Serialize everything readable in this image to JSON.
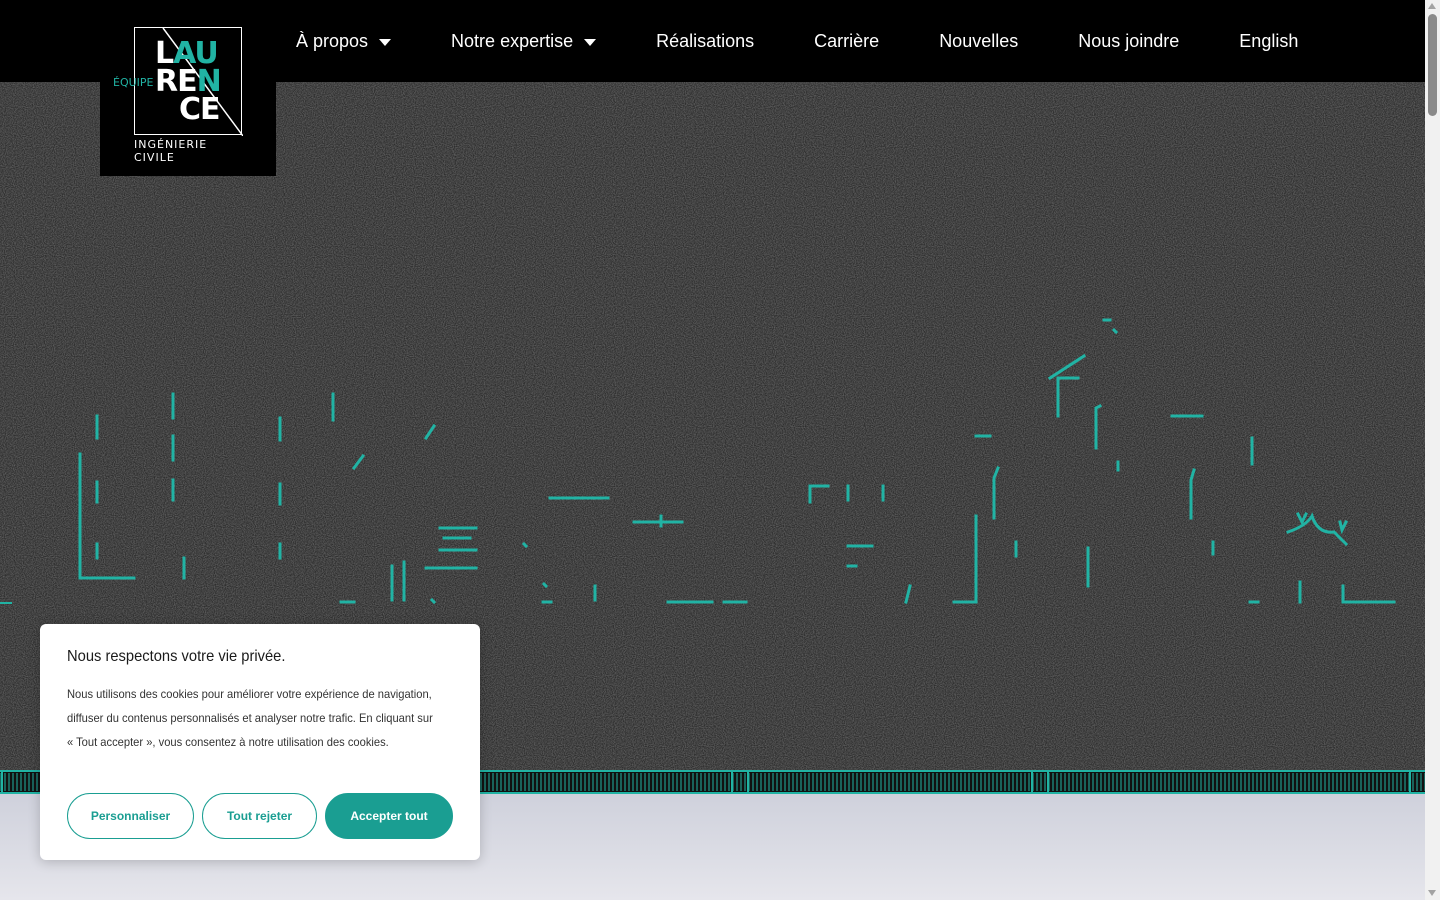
{
  "brand": {
    "equipe": "ÉQUIPE",
    "word_line1": [
      "L",
      "A",
      "U"
    ],
    "word_line2": [
      "R",
      "E",
      "N"
    ],
    "word_line3": [
      "C",
      "E"
    ],
    "subtitle": "INGÉNIERIE CIVILE",
    "accent_color": "#21b3a4"
  },
  "nav": {
    "items": [
      {
        "label": "À propos",
        "has_dropdown": true
      },
      {
        "label": "Notre expertise",
        "has_dropdown": true
      },
      {
        "label": "Réalisations",
        "has_dropdown": false
      },
      {
        "label": "Carrière",
        "has_dropdown": false
      },
      {
        "label": "Nouvelles",
        "has_dropdown": false
      },
      {
        "label": "Nous joindre",
        "has_dropdown": false
      },
      {
        "label": "English",
        "has_dropdown": false
      }
    ]
  },
  "hero": {
    "background": "asphalt-texture",
    "line_color": "#21b3a4"
  },
  "cookie": {
    "title": "Nous respectons votre vie privée.",
    "text": "Nous utilisons des cookies pour améliorer votre expérience de navigation, diffuser du contenus personnalisés et analyser notre trafic. En cliquant sur « Tout accepter », vous consentez à notre utilisation des cookies.",
    "buttons": {
      "customize": "Personnaliser",
      "reject": "Tout rejeter",
      "accept": "Accepter tout"
    },
    "button_color": "#1a9e92"
  }
}
